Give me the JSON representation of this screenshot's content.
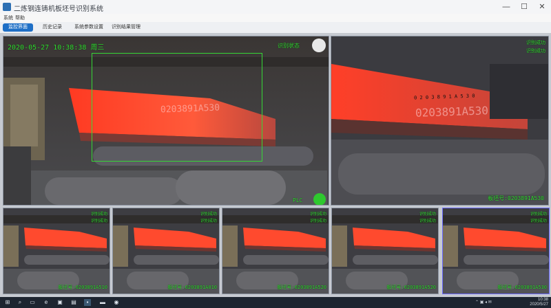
{
  "window": {
    "title": "二炼钢连铸机板坯号识别系统",
    "minimize": "—",
    "maximize": "☐",
    "close": "✕"
  },
  "menu": [
    "系统",
    "帮助"
  ],
  "tabs": [
    {
      "label": "监控界面",
      "active": true
    },
    {
      "label": "历史记录",
      "active": false
    },
    {
      "label": "系统参数设置",
      "active": false
    },
    {
      "label": "识别结果管理",
      "active": false
    }
  ],
  "main_camera": {
    "timestamp": "2020-05-27  10:38:38  周三",
    "status_label": "识别状态",
    "status_color": "#e8e8e8",
    "plc_label": "PLC",
    "plc_color": "#2ec82e",
    "plate_text": "0203891A530"
  },
  "detail_camera": {
    "status_top": "识别成功",
    "status_second": "识别成功",
    "plate_text": "0203891A530",
    "plate_upper": "0 2 0 3 8 9 1 A 5 3 0",
    "slab_label": "板坯号:0203891A530"
  },
  "thumbs": [
    {
      "status_top": "识别成功",
      "status_second": "识别成功",
      "slab_label": "板坯号:0203891A510"
    },
    {
      "status_top": "识别成功",
      "status_second": "识别成功",
      "slab_label": "板坯号:0203891A010"
    },
    {
      "status_top": "识别成功",
      "status_second": "识别成功",
      "slab_label": "板坯号:0203891A520"
    },
    {
      "status_top": "识别成功",
      "status_second": "识别成功",
      "slab_label": "板坯号:0203891A520"
    },
    {
      "status_top": "识别成功",
      "status_second": "识别成功",
      "slab_label": "板坯号:0203891A530"
    }
  ],
  "taskbar": {
    "icons": [
      "windows-icon",
      "search-icon",
      "task-view-icon",
      "edge-icon",
      "store-icon",
      "explorer-icon",
      "app-icon",
      "folder-icon",
      "camera-app-icon"
    ],
    "time": "10:38",
    "date": "2020/5/27"
  }
}
